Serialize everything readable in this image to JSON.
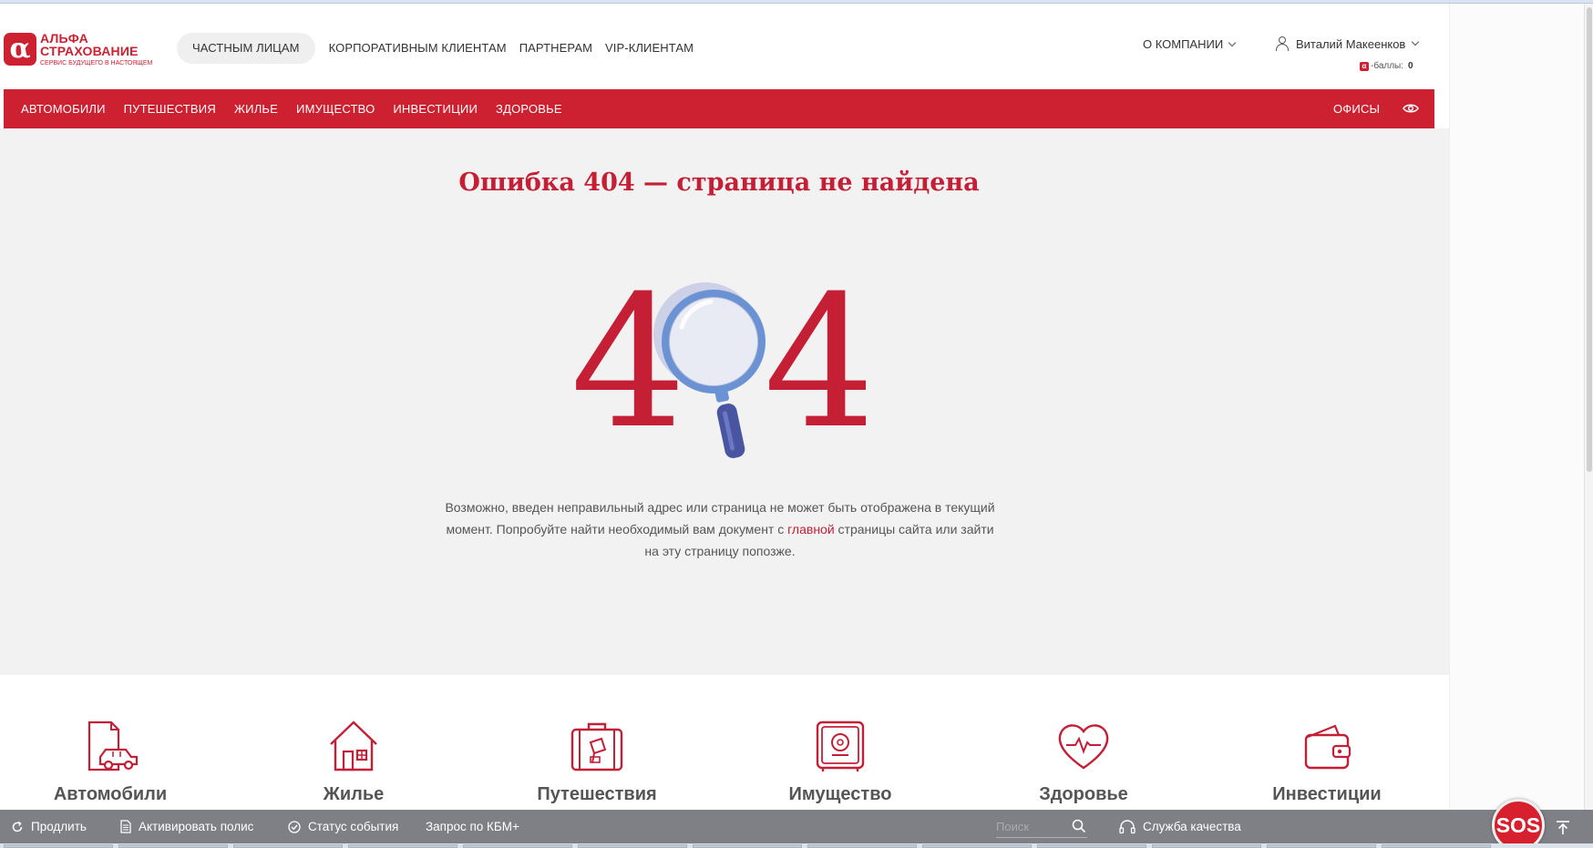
{
  "brand": {
    "logo_mark": "α",
    "name_line1": "АЛЬФА",
    "name_line2": "СТРАХОВАНИЕ",
    "tagline": "СЕРВИС БУДУЩЕГО В НАСТОЯЩЕМ",
    "accent_color": "#cd2030"
  },
  "topnav": {
    "items": [
      "ЧАСТНЫМ ЛИЦАМ",
      "КОРПОРАТИВНЫМ КЛИЕНТАМ",
      "ПАРТНЕРАМ",
      "VIP-КЛИЕНТАМ"
    ],
    "active": "ЧАСТНЫМ ЛИЦАМ",
    "company_menu": "О КОМПАНИИ",
    "user_name": "Виталий Макеенков",
    "points_label": "-баллы:",
    "points_value": "0",
    "icons": {
      "user": "user-icon",
      "dropdown": "chevron-down-icon"
    }
  },
  "category_nav": {
    "items": [
      "АВТОМОБИЛИ",
      "ПУТЕШЕСТВИЯ",
      "ЖИЛЬЕ",
      "ИМУЩЕСТВО",
      "ИНВЕСТИЦИИ",
      "ЗДОРОВЬЕ"
    ],
    "offices": "ОФИСЫ",
    "accessibility_icon": "eye-icon"
  },
  "error": {
    "title": "Ошибка 404 — страница не найдена",
    "code_left": "4",
    "code_right": "4",
    "illustration_icon": "magnifier-icon",
    "desc_before": "Возможно, введен неправильный адрес или страница не может быть отображена в текущий момент. Попробуйте найти необходимый вам документ с ",
    "desc_link": "главной",
    "desc_after": " страницы сайта или зайти на эту страницу попозже."
  },
  "categories": [
    {
      "label": "Автомобили",
      "icon": "car-document-icon"
    },
    {
      "label": "Жилье",
      "icon": "house-icon"
    },
    {
      "label": "Путешествия",
      "icon": "suitcase-icon"
    },
    {
      "label": "Имущество",
      "icon": "safe-icon"
    },
    {
      "label": "Здоровье",
      "icon": "heart-pulse-icon"
    },
    {
      "label": "Инвестиции",
      "icon": "wallet-icon"
    }
  ],
  "bottombar": {
    "renew": "Продлить",
    "activate": "Активировать полис",
    "event_status": "Статус события",
    "kbm": "Запрос по КБМ+",
    "search_placeholder": "Поиск",
    "quality": "Служба качества",
    "sos": "SOS",
    "icons": [
      "refresh-icon",
      "document-icon",
      "check-circle-icon",
      "search-icon",
      "headset-icon",
      "arrow-up-icon"
    ]
  }
}
